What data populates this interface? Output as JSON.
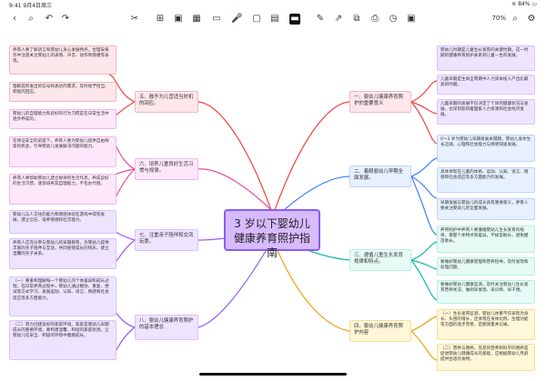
{
  "status": {
    "time": "9:41",
    "date": "9月4日周三",
    "battery": "84%"
  },
  "toolbar": {
    "zoom": "70%"
  },
  "center": {
    "title": "3 岁以下婴幼儿健康养育照护指南"
  },
  "left": {
    "cat5": {
      "title": "五、鼓予为儿营适当时机的回应。"
    },
    "cat6": {
      "title": "六、培养儿童良好生活习惯与规律。"
    },
    "cat7": {
      "title": "七、注重亲子陪伴和交流玩耍。"
    },
    "cat8": {
      "title": "八、婴幼儿健康养育照护的基本理念"
    }
  },
  "right": {
    "cat1": {
      "title": "一、婴幼儿健康养育照护的重要意义"
    },
    "cat2": {
      "title": "二、着眼婴幼儿早期全面发展。"
    },
    "cat3": {
      "title": "三、遵循儿童生长发育规律和特点。"
    },
    "cat4": {
      "title": "四、婴幼儿健康养育照护内容"
    }
  },
  "cards": {
    "l1": "养育人要了解语言和婴幼儿身心发展特点，合理安排作中注意关注婴幼儿的表情、声音、动作和情绪等表现。",
    "l2": "理解其所发出的信号和表达的需求，及时给予恰当、积极的回应。",
    "l3": "婴幼儿的自理能力和良好的行为习惯是在日常生活中逐步养成的。",
    "l4": "在保证安全的前提下，养育人要为婴幼儿提供自由探索的机会，引导婴幼儿发展解决问题的能力。",
    "l5": "养育人要帮助婴幼儿建立规律的生活作息，养成良好的生活习惯，逐渐培养其自理能力，不包办代替。",
    "l6": "婴幼儿与人交往的能力和情感体验在游戏中得到发展，建立信任、培养情感和社交能力。",
    "l7": "养育人应充分参与婴幼儿的早期教育，为婴幼儿提供丰富的亲子陪伴与互动，共同感受成长的快乐，建立温馨的亲子关系。",
    "l8a": "（一）尊重和理解每一个婴幼儿的个体差异和成长过程。在日常养育过程中，婴幼儿通过模仿、重复、尝试等方式学习，发展运动、认知、语言、情感和社会适应等多方面能力。",
    "l8b": "（二）努力创建良好的家庭环境。家庭是婴幼儿早期成长的重要环境，要构建温馨、和谐的家庭氛围，让婴幼儿在安全、积极的环境中健康成长。",
    "r1a": "婴幼儿时期是儿童生长发育的关键时期，这一时期的健康养育照护关系到儿童一生的发展。",
    "r1b": "儿童早期是生命全周期中人力资本投入产出比最高的时期。",
    "r1c": "儿童早期的发展不仅决定了个体的健康状况与发展，也深刻影响着国家人力资源和社会经济发展。",
    "r2a": "0～3 岁为婴幼儿早期发展关键期，婴幼儿身体生长迅速，心理和社会能力与情感快速发展。",
    "r2b": "具体体现在儿童的体格、运动、认知、语言、情感和社会适应等多方面能力的发展。",
    "r2c": "早期发展与婴幼儿的成长具有重要意义，养育人要关注婴幼儿的全面发展。",
    "r3a": "养育照护中养育人要遵循婴幼儿生长发育的规律，掌握个体特点和差异，不拔苗助长，避免揠苗助长。",
    "r3b": "要做好婴幼儿健康管理和营养指导，及时发现和处理问题。",
    "r3c": "要做好婴幼儿健康监测，及时关注婴幼儿生长发育营养状况，做到早发现、早诊断、早干预。",
    "r4a": "（一）生长发育监测。婴幼儿体重不仅表现为身长、头围的增长，还体现在身体比例、生理功能等方面的逐步完善，定期测量并记录。",
    "r4b": "（二）营养与喂养。充足的营养和科学的喂养是促进婴幼儿健康成长的基础，应根据婴幼儿月龄提供合适的食物。"
  }
}
